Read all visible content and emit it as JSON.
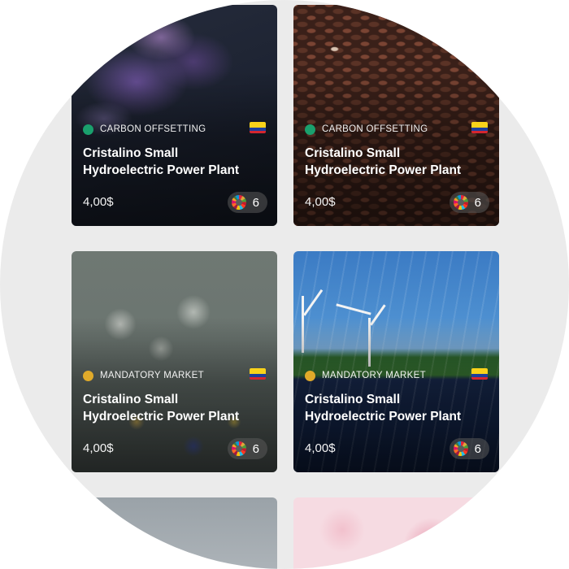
{
  "cards": [
    {
      "category": "CARBON OFFSETTING",
      "category_color": "#1aa06d",
      "title_line1": "Cristalino Small",
      "title_line2": "Hydroelectric Power Plant",
      "price": "4,00$",
      "sdg_count": "6",
      "flag": "colombia-flag-icon",
      "image": "nebula"
    },
    {
      "category": "CARBON OFFSETTING",
      "category_color": "#1aa06d",
      "title_line1": "Cristalino Small",
      "title_line2": "Hydroelectric Power Plant",
      "price": "4,00$",
      "sdg_count": "6",
      "flag": "colombia-flag-icon",
      "image": "seeds"
    },
    {
      "category": "MANDATORY MARKET",
      "category_color": "#e0aa2a",
      "title_line1": "Cristalino Small",
      "title_line2": "Hydroelectric Power Plant",
      "price": "4,00$",
      "sdg_count": "6",
      "flag": "colombia-flag-icon",
      "image": "flowers"
    },
    {
      "category": "MANDATORY MARKET",
      "category_color": "#e0aa2a",
      "title_line1": "Cristalino Small",
      "title_line2": "Hydroelectric Power Plant",
      "price": "4,00$",
      "sdg_count": "6",
      "flag": "colombia-flag-icon",
      "image": "wind-solar"
    }
  ],
  "colors": {
    "background": "#ebebeb",
    "card_text": "#ffffff"
  }
}
